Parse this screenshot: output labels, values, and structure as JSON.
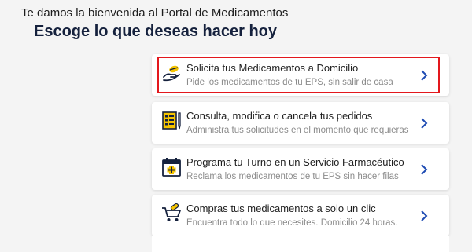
{
  "header": {
    "welcome": "Te damos la bienvenida al Portal de Medicamentos",
    "title": "Escoge lo que deseas hacer hoy"
  },
  "colors": {
    "navy": "#15213d",
    "blue": "#1e4bb3",
    "yellow": "#f5c400",
    "selection_border": "#e3181d"
  },
  "cards": [
    {
      "title": "Solicita tus Medicamentos a Domicilio",
      "subtitle": "Pide los medicamentos de tu EPS, sin salir de casa",
      "icon": "hand-pill-icon",
      "selected": true
    },
    {
      "title": "Consulta, modifica o cancela tus pedidos",
      "subtitle": "Administra tus solicitudes en el momento que requieras",
      "icon": "order-list-icon",
      "selected": false
    },
    {
      "title": "Programa tu Turno en un Servicio Farmacéutico",
      "subtitle": "Reclama los medicamentos de tu EPS sin hacer filas",
      "icon": "calendar-cross-icon",
      "selected": false
    },
    {
      "title": "Compras tus medicamentos a solo un clic",
      "subtitle": "Encuentra todo lo que necesites. Domicilio 24 horas.",
      "icon": "cart-pill-icon",
      "selected": false
    }
  ]
}
